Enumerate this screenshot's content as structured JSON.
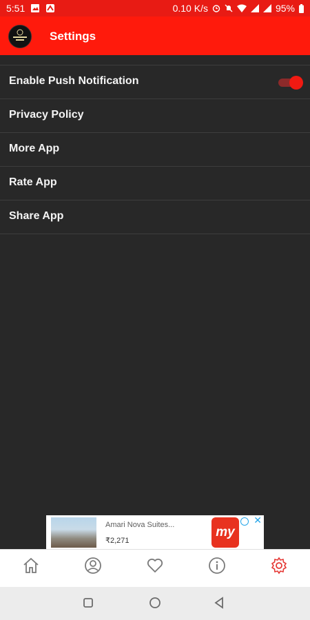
{
  "status_bar": {
    "time": "5:51",
    "network_speed": "0.10 K/s",
    "battery": "95%"
  },
  "app_bar": {
    "title": "Settings"
  },
  "settings": {
    "items": [
      {
        "label": "Enable Push Notification",
        "toggle": true
      },
      {
        "label": "Privacy Policy"
      },
      {
        "label": "More App"
      },
      {
        "label": "Rate App"
      },
      {
        "label": "Share App"
      }
    ]
  },
  "ad": {
    "title": "Amari Nova Suites...",
    "price": "₹2,271",
    "brand": "my"
  },
  "tabs": [
    {
      "icon": "home-icon"
    },
    {
      "icon": "profile-icon"
    },
    {
      "icon": "heart-icon"
    },
    {
      "icon": "info-icon"
    },
    {
      "icon": "settings-icon"
    }
  ],
  "colors": {
    "primary": "#ff1a0c",
    "background": "#282828",
    "active_tab": "#e53935"
  }
}
